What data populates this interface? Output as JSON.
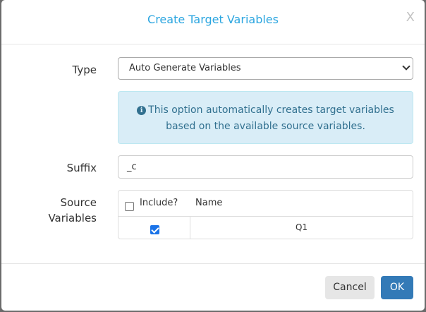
{
  "dialog": {
    "title": "Create Target Variables",
    "close_label": "X"
  },
  "form": {
    "type_label": "Type",
    "type_value": "Auto Generate Variables",
    "info_line1": "This option automatically creates target variables",
    "info_line2": "based on the available source variables.",
    "info_icon": "i",
    "suffix_label": "Suffix",
    "suffix_value": "_c",
    "source_label_line1": "Source",
    "source_label_line2": "Variables"
  },
  "table": {
    "headers": [
      "Include?",
      "Name"
    ],
    "rows": [
      {
        "include": true,
        "name": "Q1"
      }
    ]
  },
  "footer": {
    "cancel_label": "Cancel",
    "ok_label": "OK"
  },
  "colors": {
    "title": "#2ca6e0",
    "info_bg": "#d9edf7",
    "info_text": "#31708f",
    "primary": "#337ab7"
  }
}
